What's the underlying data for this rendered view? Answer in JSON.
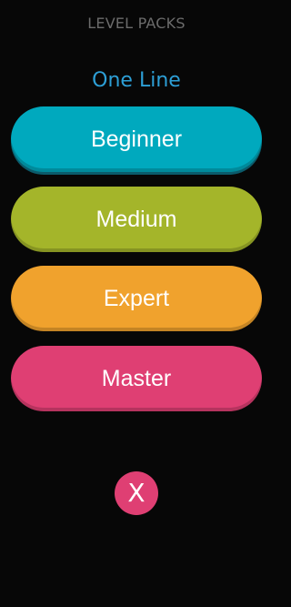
{
  "header": {
    "title": "LEVEL PACKS"
  },
  "pack": {
    "name": "One Line"
  },
  "packs": [
    {
      "label": "Beginner",
      "color": "#00a9be"
    },
    {
      "label": "Medium",
      "color": "#a4b52a"
    },
    {
      "label": "Expert",
      "color": "#f0a22d"
    },
    {
      "label": "Master",
      "color": "#df3f73"
    }
  ],
  "close": {
    "icon": "close-icon",
    "glyph": "X",
    "color": "#df3f73"
  },
  "colors": {
    "background": "#070707",
    "header_text": "#6b6b6b",
    "accent_title": "#2d9fd6"
  }
}
